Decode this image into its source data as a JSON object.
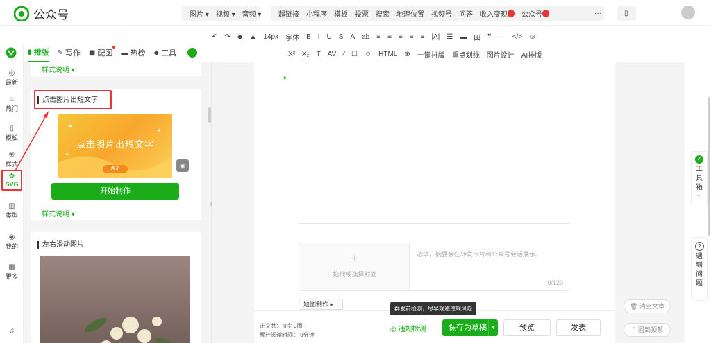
{
  "brand": {
    "name": "公众号",
    "accent": "#1aad19",
    "highlight": "#e53333"
  },
  "insert_menu_a": [
    "图片",
    "视频",
    "音频"
  ],
  "insert_menu_b": [
    "超链接",
    "小程序",
    "模板",
    "投票",
    "搜索",
    "地理位置",
    "视频号",
    "问答",
    "收入变现",
    "公众号"
  ],
  "insert_more": "···",
  "toolbar": {
    "row1": [
      "↶",
      "↷",
      "◆",
      "▲",
      "14px",
      "字体",
      "B",
      "I",
      "U",
      "S",
      "A",
      "ab",
      "≡",
      "≡",
      "≡",
      "≡",
      "≡",
      "|A|",
      "☰",
      "▬",
      "田",
      "❞",
      "—",
      "</>",
      "☺"
    ],
    "row2": [
      "X²",
      "X₂",
      "T",
      "AV",
      "⁄",
      "☐",
      "☺",
      "HTML",
      "⊕",
      "一键排版",
      "重点划线",
      "图片设计",
      "AI排版"
    ]
  },
  "tabs": [
    {
      "label": "排版",
      "icon": "▮"
    },
    {
      "label": "写作",
      "icon": "✎"
    },
    {
      "label": "配图",
      "icon": "▣"
    },
    {
      "label": "热榜",
      "icon": "▬"
    },
    {
      "label": "工具",
      "icon": "◆"
    }
  ],
  "rail": [
    {
      "label": "最新",
      "icon": "◎"
    },
    {
      "label": "热门",
      "icon": "♨"
    },
    {
      "label": "模板",
      "icon": "▯"
    },
    {
      "label": "样式",
      "icon": "❀"
    },
    {
      "label": "SVG",
      "icon": "✿"
    },
    {
      "label": "类型",
      "icon": "▥"
    },
    {
      "label": "我的",
      "icon": "◉"
    },
    {
      "label": "更多",
      "icon": "▦"
    },
    {
      "label": "",
      "icon": "♫"
    }
  ],
  "panel": {
    "style_link": "样式说明",
    "card1": {
      "title": "点击图片出短文字",
      "thumb_text": "点击图片出短文字",
      "thumb_badge": "点击",
      "start": "开始制作",
      "style_link": "样式说明"
    },
    "card2": {
      "title": "左右滑动图片"
    }
  },
  "editor": {
    "cover": "拖拽或选择封面",
    "abstract_placeholder": "选填，摘要会在转发卡片和公众号会话展示。",
    "abstract_count": "0/120",
    "title_img": "题图制作"
  },
  "footer": {
    "stat1": "正文共： 0字 0图",
    "stat2": "预计阅读时间： 0分钟",
    "tooltip": "群发前检测，尽早规避违规风险",
    "violation": "违规检测",
    "save": "保存为草稿",
    "preview": "预览",
    "publish": "发表"
  },
  "right": {
    "toolbox": "工具箱",
    "help": "遇到问题",
    "clear": "清空文章",
    "top": "回到顶部"
  }
}
